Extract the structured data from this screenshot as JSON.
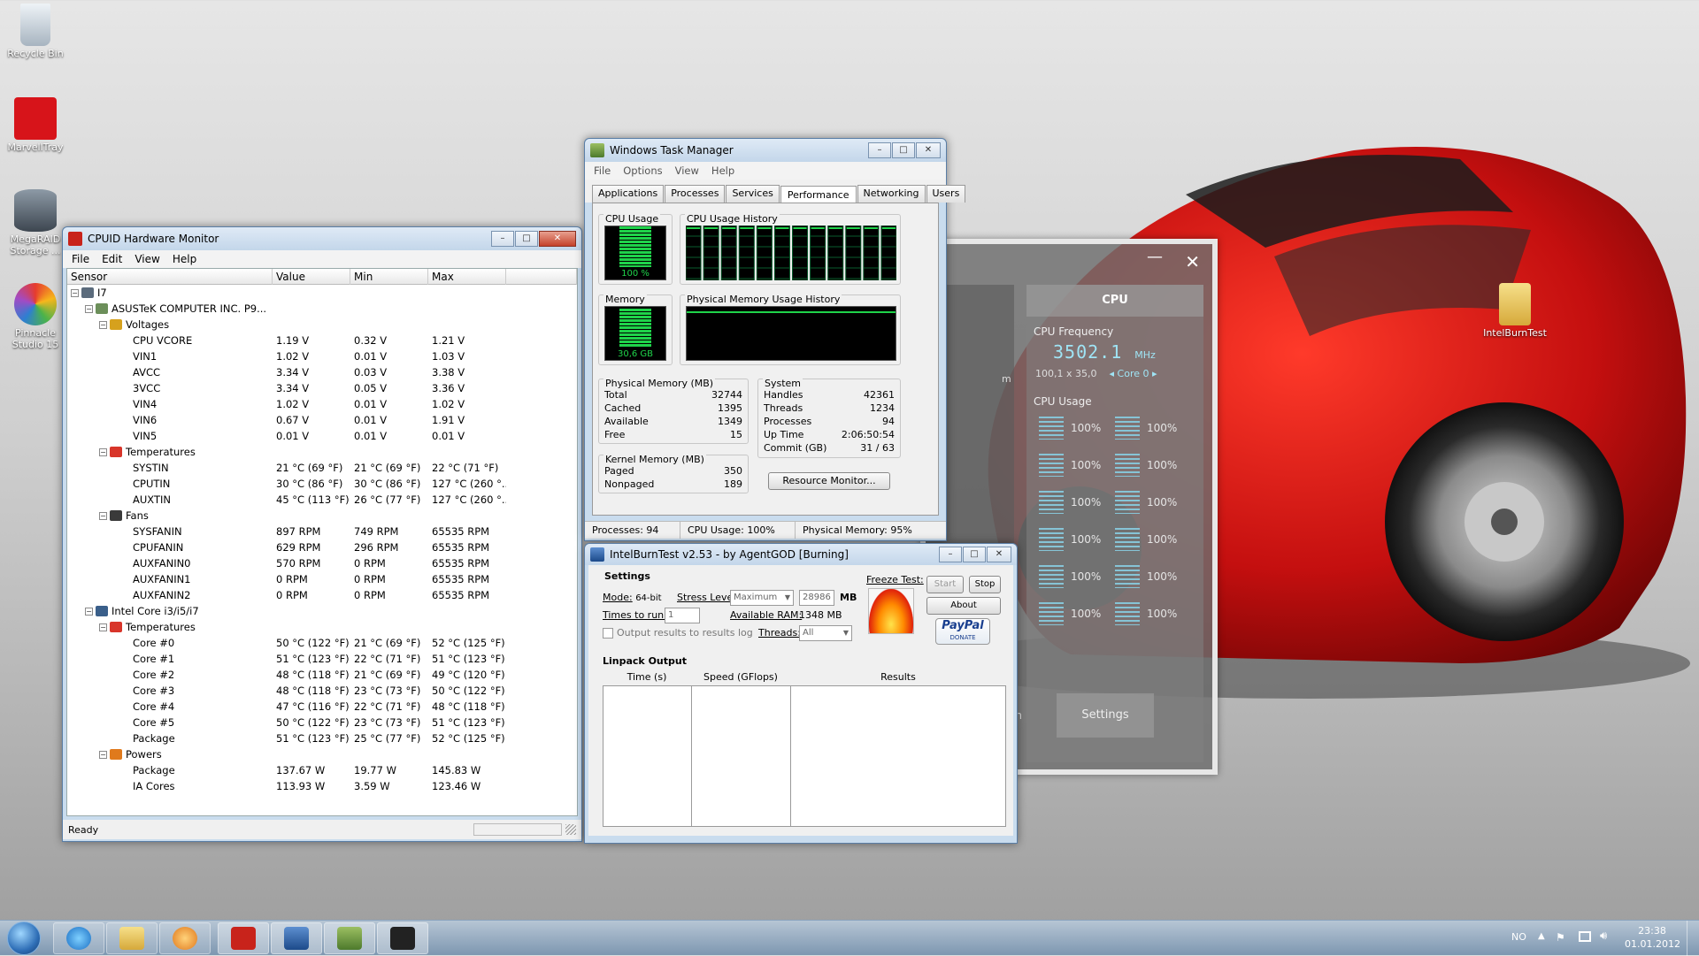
{
  "desktop": {
    "icons": [
      {
        "label": "Recycle Bin"
      },
      {
        "label": "MarvellTray"
      },
      {
        "label": "MegaRAID Storage ..."
      },
      {
        "label": "Pinnacle Studio 15"
      },
      {
        "label": "IntelBurnTest"
      }
    ]
  },
  "hwmonitor": {
    "title": "CPUID Hardware Monitor",
    "menu": [
      "File",
      "Edit",
      "View",
      "Help"
    ],
    "columns": [
      "Sensor",
      "Value",
      "Min",
      "Max"
    ],
    "status": "Ready",
    "rows": [
      {
        "depth": 0,
        "tog": "⊟",
        "icon": "computer-icon",
        "name": "I7",
        "value": "",
        "min": "",
        "max": ""
      },
      {
        "depth": 1,
        "tog": "⊟",
        "icon": "motherboard-icon",
        "name": "ASUSTeK COMPUTER INC. P9...",
        "value": "",
        "min": "",
        "max": ""
      },
      {
        "depth": 2,
        "tog": "⊟",
        "icon": "voltage-icon",
        "name": "Voltages",
        "value": "",
        "min": "",
        "max": ""
      },
      {
        "depth": 3,
        "tog": "",
        "icon": "",
        "name": "CPU VCORE",
        "value": "1.19 V",
        "min": "0.32 V",
        "max": "1.21 V"
      },
      {
        "depth": 3,
        "tog": "",
        "icon": "",
        "name": "VIN1",
        "value": "1.02 V",
        "min": "0.01 V",
        "max": "1.03 V"
      },
      {
        "depth": 3,
        "tog": "",
        "icon": "",
        "name": "AVCC",
        "value": "3.34 V",
        "min": "0.03 V",
        "max": "3.38 V"
      },
      {
        "depth": 3,
        "tog": "",
        "icon": "",
        "name": "3VCC",
        "value": "3.34 V",
        "min": "0.05 V",
        "max": "3.36 V"
      },
      {
        "depth": 3,
        "tog": "",
        "icon": "",
        "name": "VIN4",
        "value": "1.02 V",
        "min": "0.01 V",
        "max": "1.02 V"
      },
      {
        "depth": 3,
        "tog": "",
        "icon": "",
        "name": "VIN6",
        "value": "0.67 V",
        "min": "0.01 V",
        "max": "1.91 V"
      },
      {
        "depth": 3,
        "tog": "",
        "icon": "",
        "name": "VIN5",
        "value": "0.01 V",
        "min": "0.01 V",
        "max": "0.01 V"
      },
      {
        "depth": 2,
        "tog": "⊟",
        "icon": "thermometer-icon",
        "name": "Temperatures",
        "value": "",
        "min": "",
        "max": ""
      },
      {
        "depth": 3,
        "tog": "",
        "icon": "",
        "name": "SYSTIN",
        "value": "21 °C (69 °F)",
        "min": "21 °C (69 °F)",
        "max": "22 °C (71 °F)"
      },
      {
        "depth": 3,
        "tog": "",
        "icon": "",
        "name": "CPUTIN",
        "value": "30 °C (86 °F)",
        "min": "30 °C (86 °F)",
        "max": "127 °C (260 °..."
      },
      {
        "depth": 3,
        "tog": "",
        "icon": "",
        "name": "AUXTIN",
        "value": "45 °C (113 °F)",
        "min": "26 °C (77 °F)",
        "max": "127 °C (260 °..."
      },
      {
        "depth": 2,
        "tog": "⊟",
        "icon": "fan-icon",
        "name": "Fans",
        "value": "",
        "min": "",
        "max": ""
      },
      {
        "depth": 3,
        "tog": "",
        "icon": "",
        "name": "SYSFANIN",
        "value": "897 RPM",
        "min": "749 RPM",
        "max": "65535 RPM"
      },
      {
        "depth": 3,
        "tog": "",
        "icon": "",
        "name": "CPUFANIN",
        "value": "629 RPM",
        "min": "296 RPM",
        "max": "65535 RPM"
      },
      {
        "depth": 3,
        "tog": "",
        "icon": "",
        "name": "AUXFANIN0",
        "value": "570 RPM",
        "min": "0 RPM",
        "max": "65535 RPM"
      },
      {
        "depth": 3,
        "tog": "",
        "icon": "",
        "name": "AUXFANIN1",
        "value": "0 RPM",
        "min": "0 RPM",
        "max": "65535 RPM"
      },
      {
        "depth": 3,
        "tog": "",
        "icon": "",
        "name": "AUXFANIN2",
        "value": "0 RPM",
        "min": "0 RPM",
        "max": "65535 RPM"
      },
      {
        "depth": 1,
        "tog": "⊟",
        "icon": "chip-icon",
        "name": "Intel Core i3/i5/i7",
        "value": "",
        "min": "",
        "max": ""
      },
      {
        "depth": 2,
        "tog": "⊟",
        "icon": "thermometer-icon",
        "name": "Temperatures",
        "value": "",
        "min": "",
        "max": ""
      },
      {
        "depth": 3,
        "tog": "",
        "icon": "",
        "name": "Core #0",
        "value": "50 °C (122 °F)",
        "min": "21 °C (69 °F)",
        "max": "52 °C (125 °F)"
      },
      {
        "depth": 3,
        "tog": "",
        "icon": "",
        "name": "Core #1",
        "value": "51 °C (123 °F)",
        "min": "22 °C (71 °F)",
        "max": "51 °C (123 °F)"
      },
      {
        "depth": 3,
        "tog": "",
        "icon": "",
        "name": "Core #2",
        "value": "48 °C (118 °F)",
        "min": "21 °C (69 °F)",
        "max": "49 °C (120 °F)"
      },
      {
        "depth": 3,
        "tog": "",
        "icon": "",
        "name": "Core #3",
        "value": "48 °C (118 °F)",
        "min": "23 °C (73 °F)",
        "max": "50 °C (122 °F)"
      },
      {
        "depth": 3,
        "tog": "",
        "icon": "",
        "name": "Core #4",
        "value": "47 °C (116 °F)",
        "min": "22 °C (71 °F)",
        "max": "48 °C (118 °F)"
      },
      {
        "depth": 3,
        "tog": "",
        "icon": "",
        "name": "Core #5",
        "value": "50 °C (122 °F)",
        "min": "23 °C (73 °F)",
        "max": "51 °C (123 °F)"
      },
      {
        "depth": 3,
        "tog": "",
        "icon": "",
        "name": "Package",
        "value": "51 °C (123 °F)",
        "min": "25 °C (77 °F)",
        "max": "52 °C (125 °F)"
      },
      {
        "depth": 2,
        "tog": "⊟",
        "icon": "power-icon",
        "name": "Powers",
        "value": "",
        "min": "",
        "max": ""
      },
      {
        "depth": 3,
        "tog": "",
        "icon": "",
        "name": "Package",
        "value": "137.67 W",
        "min": "19.77 W",
        "max": "145.83 W"
      },
      {
        "depth": 3,
        "tog": "",
        "icon": "",
        "name": "IA Cores",
        "value": "113.93 W",
        "min": "3.59 W",
        "max": "123.46 W"
      }
    ]
  },
  "taskmgr": {
    "title": "Windows Task Manager",
    "menu": [
      "File",
      "Options",
      "View",
      "Help"
    ],
    "tabs": [
      "Applications",
      "Processes",
      "Services",
      "Performance",
      "Networking",
      "Users"
    ],
    "active_tab": 3,
    "cpu_usage_label": "CPU Usage",
    "cpu_usage_value": "100 %",
    "cpu_usage_fraction": 1.0,
    "cpu_history_label": "CPU Usage History",
    "memory_label": "Memory",
    "memory_value": "30,6 GB",
    "memory_fraction": 0.95,
    "mem_history_label": "Physical Memory Usage History",
    "physical_memory": {
      "label": "Physical Memory (MB)",
      "items": [
        {
          "k": "Total",
          "v": "32744"
        },
        {
          "k": "Cached",
          "v": "1395"
        },
        {
          "k": "Available",
          "v": "1349"
        },
        {
          "k": "Free",
          "v": "15"
        }
      ]
    },
    "kernel_memory": {
      "label": "Kernel Memory (MB)",
      "items": [
        {
          "k": "Paged",
          "v": "350"
        },
        {
          "k": "Nonpaged",
          "v": "189"
        }
      ]
    },
    "system": {
      "label": "System",
      "items": [
        {
          "k": "Handles",
          "v": "42361"
        },
        {
          "k": "Threads",
          "v": "1234"
        },
        {
          "k": "Processes",
          "v": "94"
        },
        {
          "k": "Up Time",
          "v": "2:06:50:54"
        },
        {
          "k": "Commit (GB)",
          "v": "31 / 63"
        }
      ]
    },
    "resource_monitor_button": "Resource Monitor...",
    "status": {
      "processes": "Processes: 94",
      "cpu": "CPU Usage: 100%",
      "memory": "Physical Memory: 95%"
    }
  },
  "ibt": {
    "title": "IntelBurnTest v2.53 - by AgentGOD [Burning]",
    "settings_label": "Settings",
    "mode_label": "Mode:",
    "mode_value": "64-bit",
    "stress_label": "Stress Level:",
    "stress_value": "Maximum",
    "mb_value": "28986",
    "mb_unit": "MB",
    "times_label": "Times to run:",
    "times_value": "1",
    "avail_label": "Available RAM:",
    "avail_value": "1348 MB",
    "threads_label": "Threads:",
    "threads_value": "All",
    "log_label": "Output results to results log",
    "freeze_label": "Freeze Test:",
    "start": "Start",
    "stop": "Stop",
    "about": "About",
    "paypal": "PayPal",
    "donate": "DONATE",
    "linpack_label": "Linpack Output",
    "columns": [
      "Time (s)",
      "Speed (GFlops)",
      "Results"
    ]
  },
  "gadget": {
    "tab": "CPU",
    "freq_label": "CPU Frequency",
    "freq_value": "3502.1",
    "freq_unit": "MHz",
    "multiplier": "100,1 x 35,0",
    "core": "Core 0",
    "usage_label": "CPU Usage",
    "usages": [
      "100%",
      "100%",
      "100%",
      "100%",
      "100%",
      "100%",
      "100%",
      "100%",
      "100%",
      "100%",
      "100%",
      "100%"
    ],
    "settings_button": "Settings",
    "partial_left_text": "on",
    "partial_m": "m"
  },
  "taskbar": {
    "lang": "NO",
    "time": "23:38",
    "date": "01.01.2012"
  },
  "colors": {
    "graph_green": "#1fd34a",
    "car_red": "#d31313",
    "accent_blue": "#3a78c2"
  }
}
